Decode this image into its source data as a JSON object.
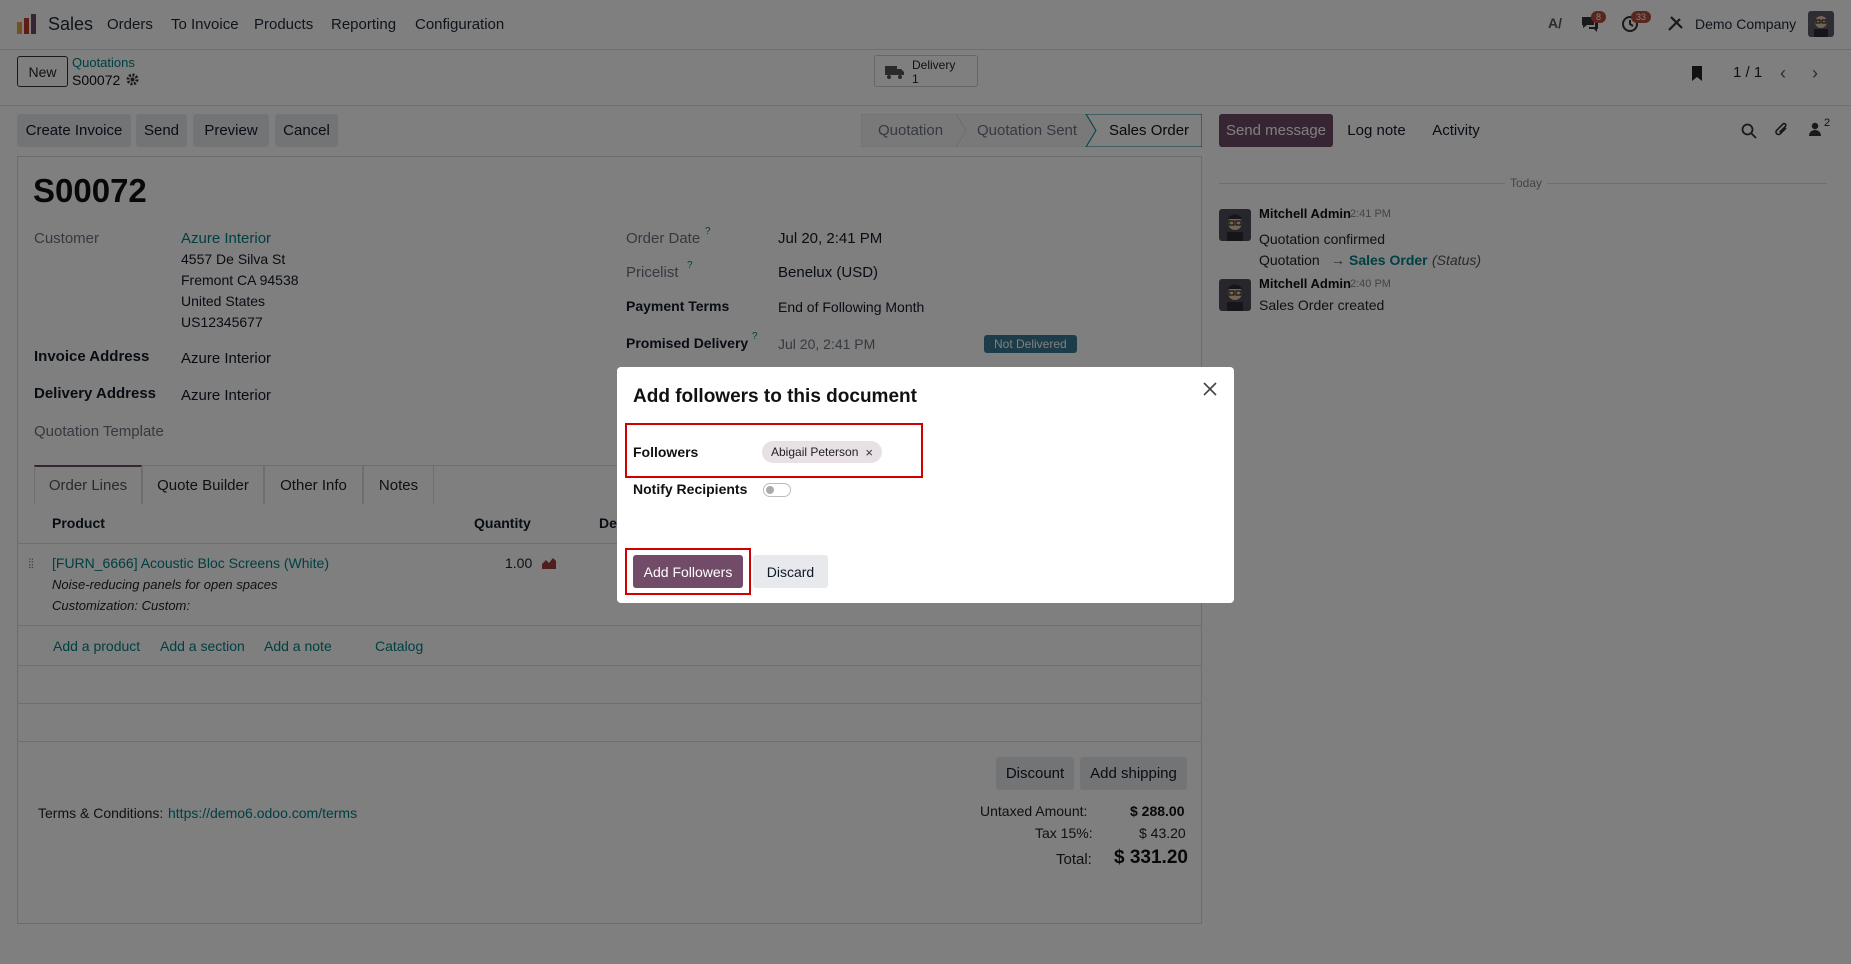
{
  "navbar": {
    "app_name": "Sales",
    "menu": [
      "Orders",
      "To Invoice",
      "Products",
      "Reporting",
      "Configuration"
    ],
    "messages_count": "8",
    "activities_count": "33",
    "company": "Demo Company"
  },
  "control_panel": {
    "new_label": "New",
    "breadcrumb_parent": "Quotations",
    "breadcrumb_current": "S00072",
    "delivery_label": "Delivery",
    "delivery_count": "1",
    "pager": "1 / 1"
  },
  "actions": {
    "create_invoice": "Create Invoice",
    "send": "Send",
    "preview": "Preview",
    "cancel": "Cancel"
  },
  "statusbar": {
    "stages": [
      "Quotation",
      "Quotation Sent",
      "Sales Order"
    ],
    "active": "Sales Order"
  },
  "form": {
    "title": "S00072",
    "customer_label": "Customer",
    "customer_name": "Azure Interior",
    "address": [
      "4557 De Silva St",
      "Fremont CA 94538",
      "United States",
      "US12345677"
    ],
    "invoice_address_label": "Invoice Address",
    "invoice_address": "Azure Interior",
    "delivery_address_label": "Delivery Address",
    "delivery_address": "Azure Interior",
    "quotation_template_label": "Quotation Template",
    "order_date_label": "Order Date",
    "order_date": "Jul 20, 2:41 PM",
    "pricelist_label": "Pricelist",
    "pricelist": "Benelux (USD)",
    "payment_terms_label": "Payment Terms",
    "payment_terms": "End of Following Month",
    "promised_delivery_label": "Promised Delivery",
    "promised_delivery": "Jul 20, 2:41 PM",
    "delivery_status": "Not Delivered",
    "tooltip_mark": "?"
  },
  "tabs": [
    "Order Lines",
    "Quote Builder",
    "Other Info",
    "Notes"
  ],
  "order_lines": {
    "col_product": "Product",
    "col_quantity": "Quantity",
    "col_desc_partial": "De",
    "line_product": "[FURN_6666] Acoustic Bloc Screens (White)",
    "line_desc1": "Noise-reducing panels for open spaces",
    "line_desc2": "Customization: Custom:",
    "line_qty": "1.00",
    "add_product": "Add a product",
    "add_section": "Add a section",
    "add_note": "Add a note",
    "catalog": "Catalog"
  },
  "footer": {
    "discount": "Discount",
    "add_shipping": "Add shipping",
    "terms_label": "Terms & Conditions:",
    "terms_link": "https://demo6.odoo.com/terms",
    "untaxed_label": "Untaxed Amount:",
    "untaxed_value": "$ 288.00",
    "tax_label": "Tax 15%:",
    "tax_value": "$ 43.20",
    "total_label": "Total:",
    "total_value": "$ 331.20"
  },
  "chatter": {
    "send_message": "Send message",
    "log_note": "Log note",
    "activity": "Activity",
    "followers_count": "2",
    "today": "Today",
    "msg1_author": "Mitchell Admin",
    "msg1_time": "2:41 PM",
    "msg1_text": "Quotation confirmed",
    "msg1_change_from": "Quotation",
    "msg1_arrow": "→",
    "msg1_change_to": "Sales Order",
    "msg1_field": "(Status)",
    "msg2_author": "Mitchell Admin",
    "msg2_time": "2:40 PM",
    "msg2_text": "Sales Order created"
  },
  "dialog": {
    "title": "Add followers to this document",
    "followers_label": "Followers",
    "follower_tag": "Abigail Peterson",
    "notify_label": "Notify Recipients",
    "add_button": "Add Followers",
    "discard_button": "Discard"
  },
  "colors": {
    "primary": "#714b67",
    "link": "#017e84",
    "status_badge": "#3b7893",
    "highlight": "#d10000"
  }
}
